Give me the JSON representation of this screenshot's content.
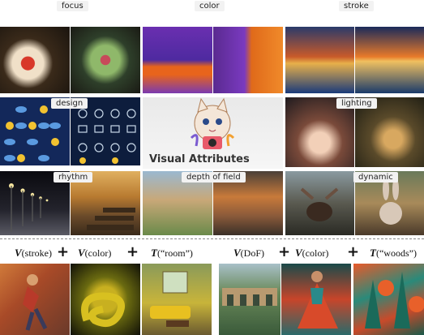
{
  "attribute_labels": {
    "focus": "focus",
    "color": "color",
    "stroke": "stroke",
    "design": "design",
    "lighting": "lighting",
    "rhythm": "rhythm",
    "depth_of_field": "depth of field",
    "dynamic": "dynamic"
  },
  "center_title": "Visual Attributes",
  "composition_row": {
    "left": {
      "v1": "V",
      "v1_arg": "(stroke)",
      "v2": "V",
      "v2_arg": "(color)",
      "t": "T",
      "t_arg": "(“room”)",
      "plus": "+"
    },
    "right": {
      "v1": "V",
      "v1_arg": "(DoF)",
      "v2": "V",
      "v2_arg": "(color)",
      "t": "T",
      "t_arg": "(“woods”)",
      "plus": "+"
    }
  }
}
